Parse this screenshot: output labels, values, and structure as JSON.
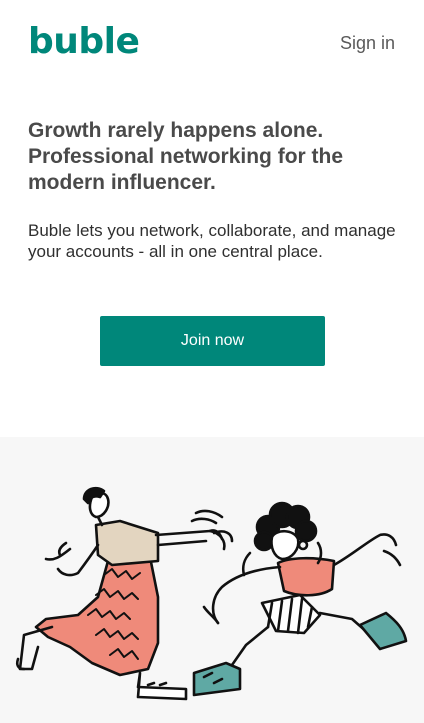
{
  "header": {
    "logo_text": "buble",
    "signin_label": "Sign in"
  },
  "hero": {
    "title": "Growth rarely happens alone. Professional networking for the modern influencer.",
    "description": "Buble lets you network, collaborate, and manage your accounts - all in one central place.",
    "cta_label": "Join now"
  },
  "illustration": {
    "subject": "two people running"
  },
  "colors": {
    "brand": "#00877a",
    "accent_coral": "#ef8a7a",
    "accent_teal": "#5fa9a4",
    "accent_beige": "#e3d5c0"
  }
}
